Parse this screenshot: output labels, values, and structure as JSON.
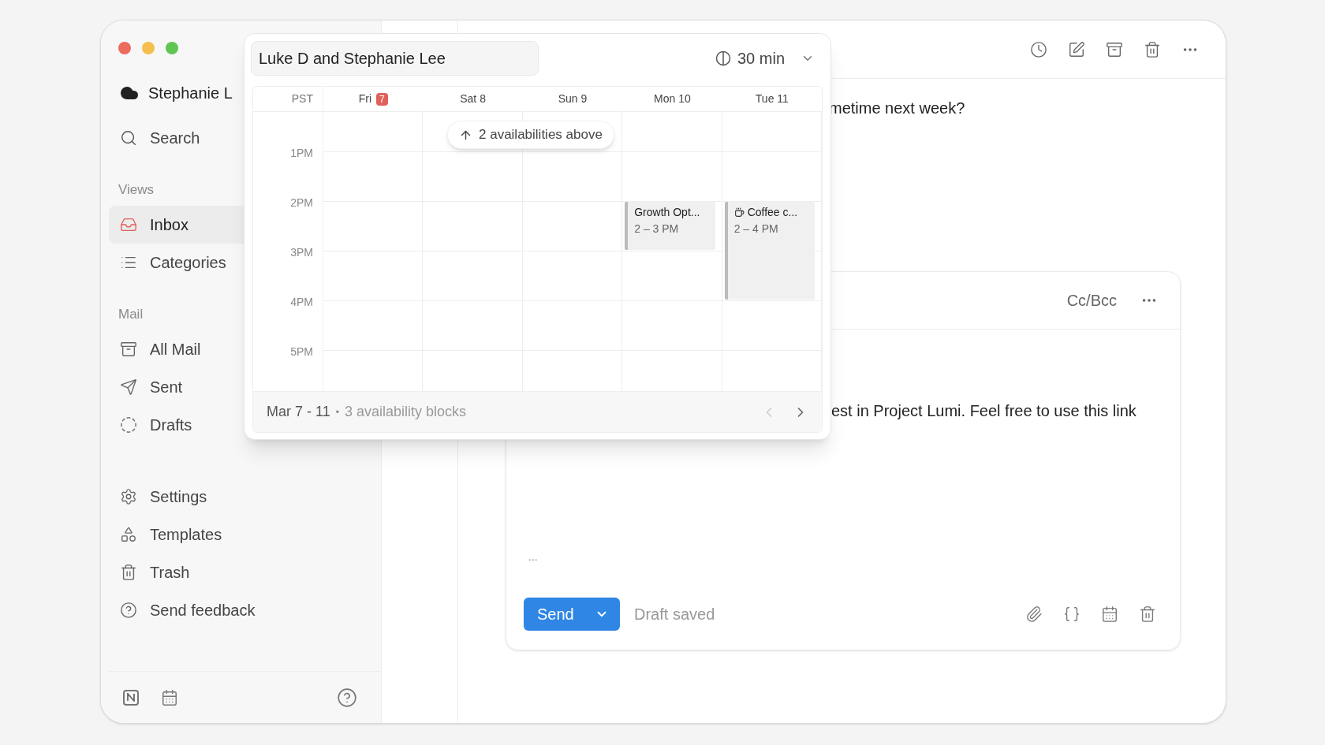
{
  "sidebar": {
    "account": "Stephanie L",
    "search": "Search",
    "sections": [
      {
        "title": "Views",
        "items": [
          {
            "label": "Inbox",
            "kind": "inbox",
            "selected": true
          },
          {
            "label": "Categories",
            "kind": "list",
            "selected": false
          }
        ]
      },
      {
        "title": "Mail",
        "items": [
          {
            "label": "All Mail",
            "kind": "archive",
            "selected": false
          },
          {
            "label": "Sent",
            "kind": "send",
            "selected": false
          },
          {
            "label": "Drafts",
            "kind": "draft",
            "selected": false
          }
        ]
      },
      {
        "items": [
          {
            "label": "Settings",
            "kind": "settings",
            "selected": false
          },
          {
            "label": "Templates",
            "kind": "templates",
            "selected": false
          },
          {
            "label": "Trash",
            "kind": "trash",
            "selected": false
          },
          {
            "label": "Send feedback",
            "kind": "help",
            "selected": false
          }
        ]
      }
    ]
  },
  "message": {
    "text": "metime next week?"
  },
  "compose": {
    "cc_bcc": "Cc/Bcc",
    "body": "est in Project Lumi. Feel free to use this link",
    "ellipsis": "...",
    "send": "Send",
    "status": "Draft saved"
  },
  "scheduler": {
    "title": "Luke D and Stephanie Lee",
    "duration": "30 min",
    "timezone": "PST",
    "days": [
      {
        "label": "Fri",
        "badge": "7"
      },
      {
        "label": "Sat 8"
      },
      {
        "label": "Sun 9"
      },
      {
        "label": "Mon 10",
        "events": [
          {
            "title": "Growth Opt...",
            "time": "2 – 3 PM",
            "kind": "plain"
          }
        ]
      },
      {
        "label": "Tue 11",
        "events": [
          {
            "title": "Coffee c...",
            "time": "2 – 4 PM",
            "kind": "coffee"
          }
        ]
      }
    ],
    "hours": [
      "1PM",
      "2PM",
      "3PM",
      "4PM",
      "5PM"
    ],
    "notice": "2 availabilities above",
    "range": "Mar 7 - 11",
    "separator": "•",
    "blocks": "3 availability blocks"
  }
}
